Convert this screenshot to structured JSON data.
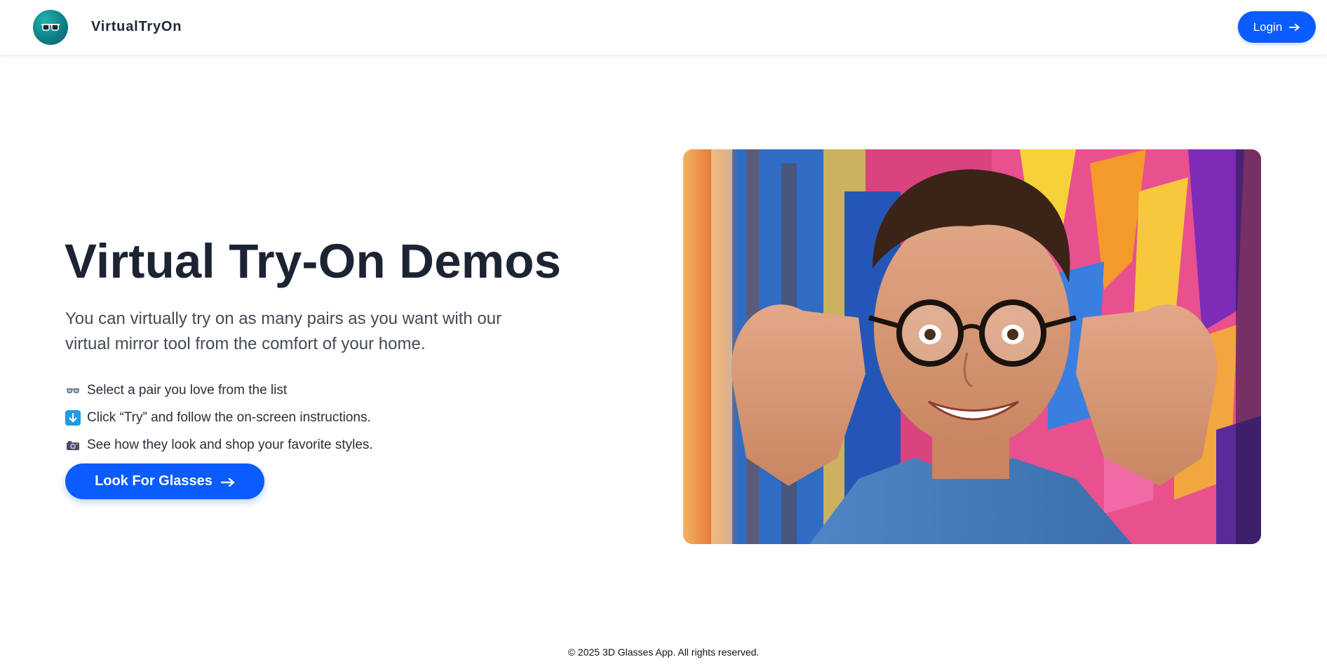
{
  "header": {
    "brand": "VirtualTryOn",
    "logo_icon": "glasses-icon",
    "login_label": "Login"
  },
  "hero": {
    "title": "Virtual Try-On Demos",
    "subtitle": "You can virtually try on as many pairs as you want with our virtual mirror tool from the comfort of your home.",
    "steps": [
      {
        "icon": "glasses-icon",
        "text": "Select a pair you love from the list"
      },
      {
        "icon": "down-arrow-icon",
        "text": "Click “Try” and follow the on-screen instructions."
      },
      {
        "icon": "camera-icon",
        "text": "See how they look and shop your favorite styles."
      }
    ],
    "cta_label": "Look For Glasses",
    "image_alt": "Smiling man adjusting glasses in front of colorful graffiti wall"
  },
  "footer": {
    "text": "© 2025 3D Glasses App. All rights reserved."
  },
  "colors": {
    "accent": "#0a5cff",
    "logo": "#0f7f86",
    "title": "#1c2333"
  }
}
